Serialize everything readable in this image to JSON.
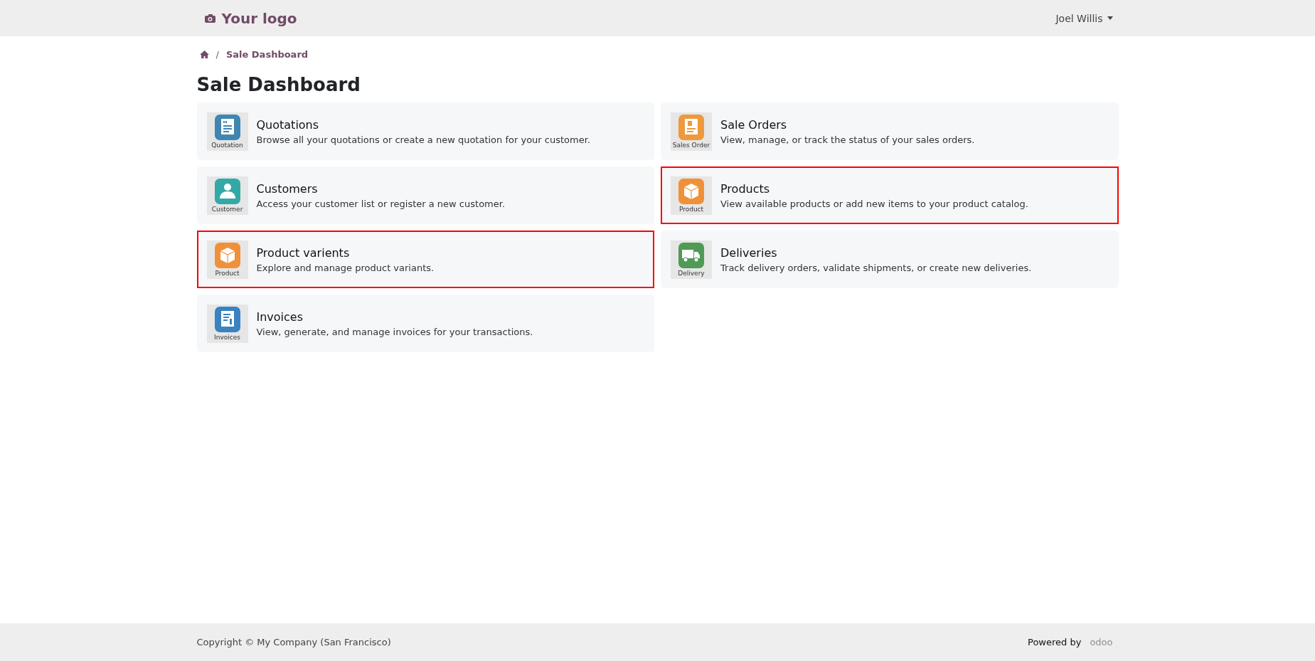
{
  "header": {
    "logo": "Your logo",
    "user": "Joel Willis"
  },
  "breadcrumb": {
    "separator": "/",
    "current": "Sale Dashboard"
  },
  "title": "Sale Dashboard",
  "cards": [
    {
      "title": "Quotations",
      "description": "Browse all your quotations or create a new quotation for your customer.",
      "icon": {
        "kind": "document",
        "color": "#3f86b0",
        "caption": "Quotation"
      },
      "highlighted": false
    },
    {
      "title": "Sale Orders",
      "description": "View, manage, or track the status of your sales orders.",
      "icon": {
        "kind": "order",
        "color": "#ee9a3c",
        "caption": "Sales Order"
      },
      "highlighted": false
    },
    {
      "title": "Customers",
      "description": "Access your customer list or register a new customer.",
      "icon": {
        "kind": "person",
        "color": "#33a9a7",
        "caption": "Customer"
      },
      "highlighted": false
    },
    {
      "title": "Products",
      "description": "View available products or add new items to your product catalog.",
      "icon": {
        "kind": "box",
        "color": "#f0913a",
        "caption": "Product"
      },
      "highlighted": true
    },
    {
      "title": "Product varients",
      "description": "Explore and manage product variants.",
      "icon": {
        "kind": "box",
        "color": "#f0913a",
        "caption": "Product"
      },
      "highlighted": true
    },
    {
      "title": "Deliveries",
      "description": "Track delivery orders, validate shipments, or create new deliveries.",
      "icon": {
        "kind": "truck",
        "color": "#4f9a55",
        "caption": "Delivery"
      },
      "highlighted": false
    },
    {
      "title": "Invoices",
      "description": "View, generate, and manage invoices for your transactions.",
      "icon": {
        "kind": "invoice",
        "color": "#3a82c0",
        "caption": "Invoices"
      },
      "highlighted": false
    }
  ],
  "footer": {
    "copyright": "Copyright © My Company (San Francisco)",
    "powered_by": "Powered by",
    "brand": "odoo"
  }
}
